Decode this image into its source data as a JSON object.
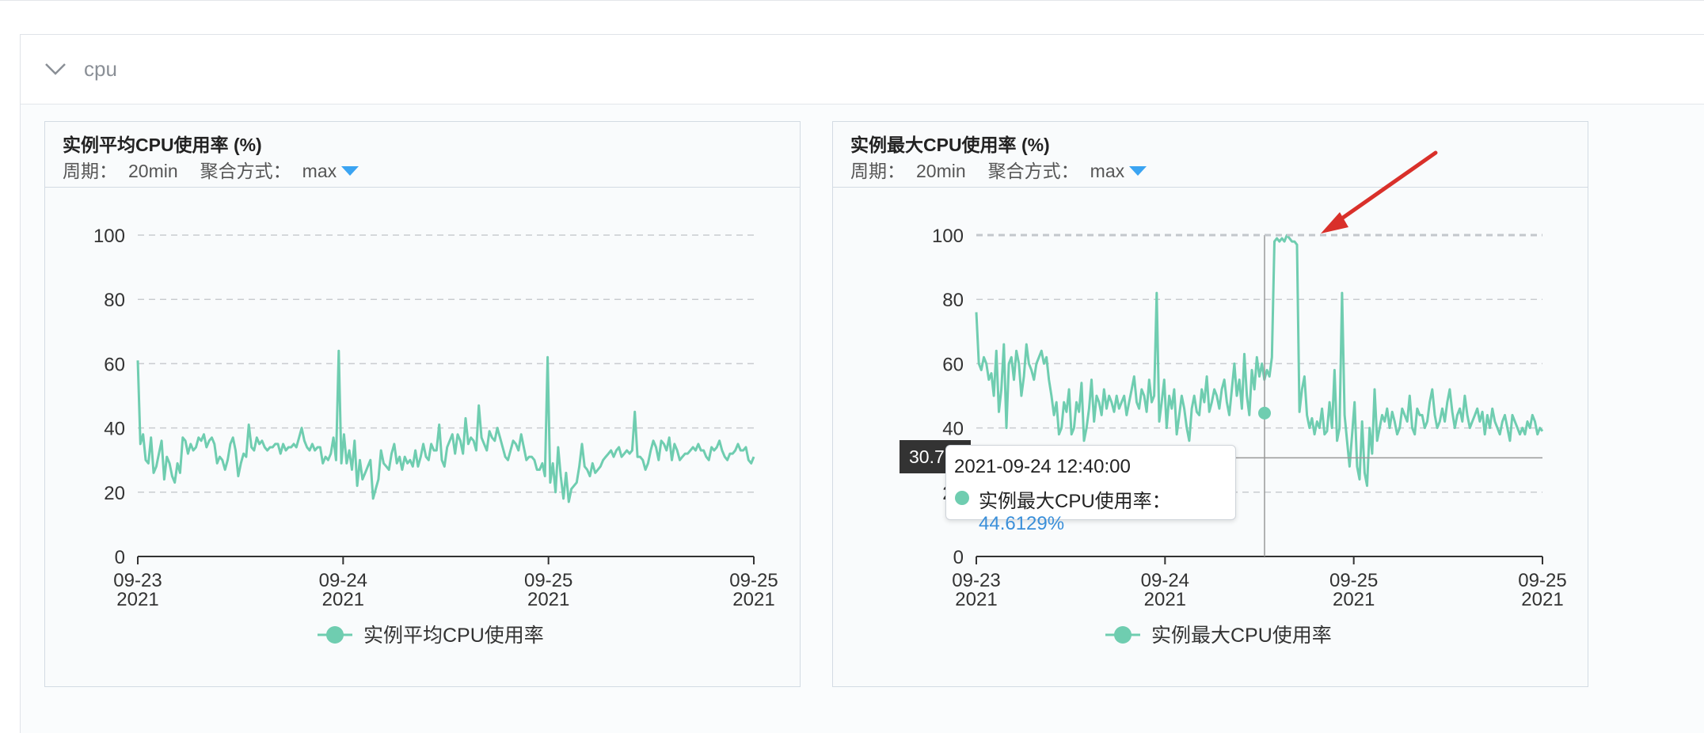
{
  "section": {
    "title": "cpu"
  },
  "panels": [
    {
      "title": "实例平均CPU使用率 (%)",
      "period_label": "周期：",
      "period_value": "20min",
      "agg_label": "聚合方式：",
      "agg_value": "max",
      "legend": "实例平均CPU使用率"
    },
    {
      "title": "实例最大CPU使用率 (%)",
      "period_label": "周期：",
      "period_value": "20min",
      "agg_label": "聚合方式：",
      "agg_value": "max",
      "legend": "实例最大CPU使用率"
    }
  ],
  "tooltip": {
    "time": "2021-09-24 12:40:00",
    "series_name": "实例最大CPU使用率：",
    "value": "44.6129%",
    "axis_label": "30.7"
  },
  "colors": {
    "series": "#6fcdb0",
    "accent": "#3ba4f2",
    "annotation_arrow": "#d9302a"
  },
  "chart_data": [
    {
      "type": "line",
      "ylim": [
        0,
        100
      ],
      "yticks": [
        "0",
        "20",
        "40",
        "60",
        "80",
        "100"
      ],
      "xtick_labels": [
        [
          "09-23",
          "2021"
        ],
        [
          "09-24",
          "2021"
        ],
        [
          "09-25",
          "2021"
        ],
        [
          "09-25",
          "2021"
        ]
      ],
      "grid": true,
      "legend_position": "bottom",
      "series": [
        {
          "name": "实例平均CPU使用率",
          "values": [
            61,
            35,
            38,
            30,
            29,
            37,
            26,
            28,
            32,
            36,
            24,
            31,
            29,
            25,
            23,
            29,
            26,
            37,
            36,
            32,
            35,
            33,
            34,
            37,
            36,
            38,
            34,
            36,
            37,
            35,
            29,
            31,
            30,
            27,
            30,
            35,
            37,
            33,
            25,
            29,
            32,
            31,
            41,
            34,
            33,
            37,
            35,
            36,
            34,
            33,
            34,
            34,
            35,
            35,
            32,
            35,
            33,
            34,
            34,
            35,
            34,
            37,
            40,
            36,
            34,
            33,
            35,
            33,
            34,
            34,
            29,
            31,
            30,
            32,
            37,
            30,
            64,
            29,
            38,
            29,
            33,
            27,
            36,
            22,
            30,
            24,
            26,
            28,
            30,
            18,
            21,
            24,
            33,
            29,
            28,
            27,
            32,
            35,
            29,
            31,
            27,
            31,
            29,
            30,
            28,
            33,
            28,
            31,
            35,
            31,
            30,
            35,
            33,
            33,
            41,
            30,
            28,
            34,
            36,
            38,
            32,
            38,
            36,
            32,
            43,
            35,
            37,
            36,
            33,
            47,
            37,
            35,
            33,
            39,
            37,
            36,
            40,
            37,
            34,
            31,
            30,
            33,
            36,
            35,
            33,
            38,
            34,
            30,
            31,
            31,
            30,
            27,
            27,
            29,
            25,
            62,
            23,
            29,
            20,
            34,
            25,
            18,
            26,
            17,
            21,
            22,
            23,
            28,
            35,
            28,
            27,
            25,
            29,
            26,
            27,
            28,
            30,
            31,
            32,
            33,
            31,
            33,
            34,
            31,
            32,
            33,
            32,
            33,
            45,
            31,
            31,
            30,
            27,
            29,
            33,
            36,
            34,
            30,
            36,
            35,
            33,
            37,
            30,
            35,
            33,
            30,
            31,
            32,
            32,
            33,
            34,
            33,
            35,
            33,
            33,
            31,
            30,
            34,
            33,
            34,
            36,
            33,
            31,
            30,
            32,
            32,
            33,
            35,
            33,
            33,
            34,
            30,
            29,
            31
          ]
        }
      ]
    },
    {
      "type": "line",
      "ylim": [
        0,
        100
      ],
      "yticks": [
        "0",
        "20",
        "40",
        "60",
        "80",
        "100"
      ],
      "xtick_labels": [
        [
          "09-23",
          "2021"
        ],
        [
          "09-24",
          "2021"
        ],
        [
          "09-25",
          "2021"
        ],
        [
          "09-25",
          "2021"
        ]
      ],
      "grid": true,
      "legend_position": "bottom",
      "series": [
        {
          "name": "实例最大CPU使用率",
          "values": [
            76,
            60,
            58,
            62,
            60,
            55,
            57,
            50,
            64,
            45,
            52,
            66,
            40,
            60,
            62,
            55,
            64,
            60,
            50,
            56,
            66,
            60,
            58,
            55,
            60,
            62,
            64,
            60,
            62,
            55,
            50,
            44,
            48,
            38,
            40,
            48,
            45,
            52,
            38,
            40,
            48,
            45,
            54,
            36,
            40,
            46,
            55,
            42,
            50,
            48,
            44,
            52,
            46,
            50,
            48,
            45,
            50,
            46,
            48,
            50,
            44,
            48,
            52,
            56,
            48,
            46,
            52,
            50,
            45,
            55,
            48,
            50,
            82,
            42,
            48,
            55,
            40,
            50,
            46,
            52,
            38,
            44,
            50,
            46,
            40,
            36,
            46,
            50,
            45,
            44,
            52,
            48,
            56,
            45,
            48,
            52,
            50,
            46,
            52,
            55,
            48,
            44,
            52,
            60,
            50,
            55,
            46,
            63,
            50,
            44,
            58,
            52,
            62,
            56,
            60,
            55,
            58,
            56,
            62,
            98,
            99,
            98,
            99,
            98,
            100,
            99,
            98,
            98,
            97,
            45,
            52,
            56,
            44,
            40,
            43,
            38,
            42,
            40,
            46,
            38,
            39,
            48,
            40,
            58,
            36,
            40,
            82,
            44,
            36,
            28,
            38,
            48,
            28,
            24,
            42,
            26,
            22,
            40,
            32,
            52,
            36,
            40,
            44,
            42,
            46,
            40,
            45,
            42,
            38,
            40,
            46,
            44,
            42,
            50,
            40,
            38,
            46,
            44,
            44,
            40,
            42,
            48,
            52,
            44,
            40,
            42,
            46,
            42,
            48,
            52,
            45,
            40,
            44,
            46,
            42,
            50,
            44,
            40,
            42,
            44,
            46,
            42,
            45,
            38,
            44,
            40,
            46,
            42,
            40,
            38,
            42,
            44,
            40,
            36,
            44,
            42,
            40,
            38,
            40,
            38,
            42,
            40,
            44,
            42,
            38,
            40,
            39
          ]
        }
      ]
    }
  ]
}
